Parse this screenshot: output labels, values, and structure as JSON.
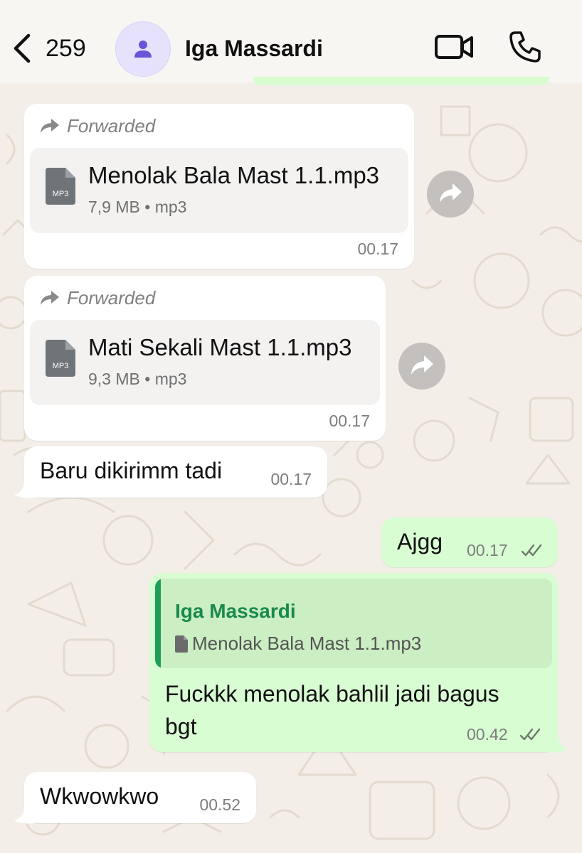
{
  "header": {
    "unread_count": "259",
    "contact_name": "Iga Massardi",
    "icons": {
      "back": "chevron-left-icon",
      "avatar": "person-icon",
      "video": "video-camera-icon",
      "call": "phone-icon"
    }
  },
  "messages": [
    {
      "direction": "in",
      "forwarded_label": "Forwarded",
      "file_name": "Menolak Bala Mast 1.1.mp3",
      "file_meta": "7,9 MB • mp3",
      "file_icon_label": "MP3",
      "time": "00.17"
    },
    {
      "direction": "in",
      "forwarded_label": "Forwarded",
      "file_name": "Mati Sekali Mast 1.1.mp3",
      "file_meta": "9,3 MB • mp3",
      "file_icon_label": "MP3",
      "time": "00.17"
    },
    {
      "direction": "in",
      "text": "Baru dikirimm tadi",
      "time": "00.17"
    },
    {
      "direction": "out",
      "text": "Ajgg",
      "time": "00.17",
      "status": "read"
    },
    {
      "direction": "out",
      "reply_to_name": "Iga Massardi",
      "reply_to_file": "Menolak Bala Mast 1.1.mp3",
      "text_line1": "Fuckkk menolak bahlil jadi bagus",
      "text_line2": "bgt",
      "time": "00.42",
      "status": "read"
    },
    {
      "direction": "in",
      "text": "Wkwowkwo",
      "time": "00.52"
    }
  ],
  "colors": {
    "chat_background": "#f3efe8",
    "outgoing_bubble": "#d9fdd3",
    "incoming_bubble": "#ffffff",
    "reply_accent": "#1f9e5a",
    "avatar_bg": "#e6e2fb",
    "avatar_fg": "#6b54d8"
  }
}
